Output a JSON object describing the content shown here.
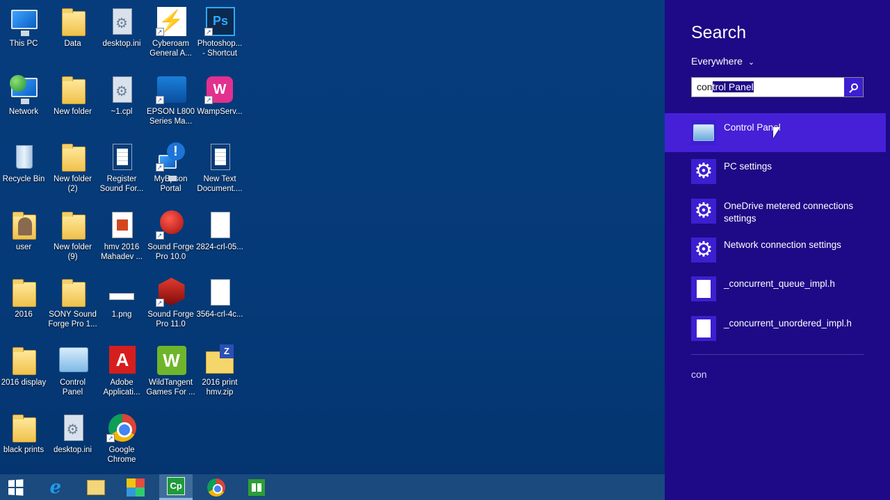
{
  "desktop": {
    "icons": [
      {
        "label": "This PC",
        "icon": "computer-icon"
      },
      {
        "label": "Data",
        "icon": "folder-icon"
      },
      {
        "label": "desktop.ini",
        "icon": "settings-file-icon"
      },
      {
        "label": "Cyberoam\nGeneral A...",
        "icon": "cyberoam-icon",
        "shortcut": true
      },
      {
        "label": "Photoshop...\n- Shortcut",
        "icon": "photoshop-icon",
        "shortcut": true
      },
      {
        "label": "Network",
        "icon": "network-icon"
      },
      {
        "label": "New folder",
        "icon": "folder-icon"
      },
      {
        "label": "~1.cpl",
        "icon": "settings-file-icon"
      },
      {
        "label": "EPSON L800\nSeries Ma...",
        "icon": "epson-icon",
        "shortcut": true
      },
      {
        "label": "WampServ...",
        "icon": "wampserver-icon",
        "shortcut": true
      },
      {
        "label": "Recycle Bin",
        "icon": "recycle-bin-icon"
      },
      {
        "label": "New folder\n(2)",
        "icon": "folder-icon"
      },
      {
        "label": "Register\nSound For...",
        "icon": "document-icon"
      },
      {
        "label": "MyEpson\nPortal",
        "icon": "myepson-icon",
        "shortcut": true
      },
      {
        "label": "New Text\nDocument....",
        "icon": "text-document-icon"
      },
      {
        "label": "user",
        "icon": "user-folder-icon"
      },
      {
        "label": "New folder\n(9)",
        "icon": "folder-icon"
      },
      {
        "label": "hmv 2016\nMahadev ...",
        "icon": "hmv-icon"
      },
      {
        "label": "Sound Forge\nPro 10.0",
        "icon": "sound-forge-icon",
        "shortcut": true
      },
      {
        "label": "2824-crl-05...",
        "icon": "blank-file-icon"
      },
      {
        "label": "2016",
        "icon": "folder-icon"
      },
      {
        "label": "SONY Sound\nForge Pro 1...",
        "icon": "folder-icon"
      },
      {
        "label": "1.png",
        "icon": "image-file-icon"
      },
      {
        "label": "Sound Forge\nPro 11.0",
        "icon": "sound-forge-icon",
        "shortcut": true
      },
      {
        "label": "3564-crl-4c...",
        "icon": "blank-file-icon"
      },
      {
        "label": "2016 display",
        "icon": "folder-icon"
      },
      {
        "label": "Control\nPanel",
        "icon": "control-panel-icon"
      },
      {
        "label": "Adobe\nApplicati...",
        "icon": "adobe-icon"
      },
      {
        "label": "WildTangent\nGames For ...",
        "icon": "wildtangent-icon"
      },
      {
        "label": "2016 print\nhmv.zip",
        "icon": "zip-file-icon"
      },
      {
        "label": "black prints",
        "icon": "folder-icon"
      },
      {
        "label": "desktop.ini",
        "icon": "settings-file-icon"
      },
      {
        "label": "Google\nChrome",
        "icon": "chrome-icon",
        "shortcut": true
      }
    ]
  },
  "taskbar": {
    "items": [
      {
        "name": "start-button",
        "icon": "windows-logo-icon"
      },
      {
        "name": "internet-explorer",
        "icon": "internet-explorer-icon"
      },
      {
        "name": "file-explorer",
        "icon": "file-explorer-icon"
      },
      {
        "name": "photo-app",
        "icon": "mosaic-app-icon"
      },
      {
        "name": "camtasia",
        "icon": "camtasia-icon",
        "label": "Cp",
        "active": true
      },
      {
        "name": "chrome",
        "icon": "chrome-icon"
      },
      {
        "name": "store",
        "icon": "store-icon"
      }
    ]
  },
  "search": {
    "title": "Search",
    "scope": "Everywhere",
    "query_typed": "con",
    "query_selected": "trol Panel",
    "results": [
      {
        "label": "Control Panel",
        "icon": "control-panel-icon",
        "highlighted": true
      },
      {
        "label": "PC settings",
        "icon": "gear-icon"
      },
      {
        "label": "OneDrive metered connections settings",
        "icon": "gear-icon"
      },
      {
        "label": "Network connection settings",
        "icon": "gear-icon"
      },
      {
        "label": "_concurrent_queue_impl.h",
        "icon": "file-icon"
      },
      {
        "label": "_concurrent_unordered_impl.h",
        "icon": "file-icon"
      }
    ],
    "history_term": "con"
  },
  "colors": {
    "desktop_bg": "#063b7a",
    "charm_bg": "#1e0a86",
    "highlight": "#4520d7",
    "accent": "#3c1fd1"
  }
}
